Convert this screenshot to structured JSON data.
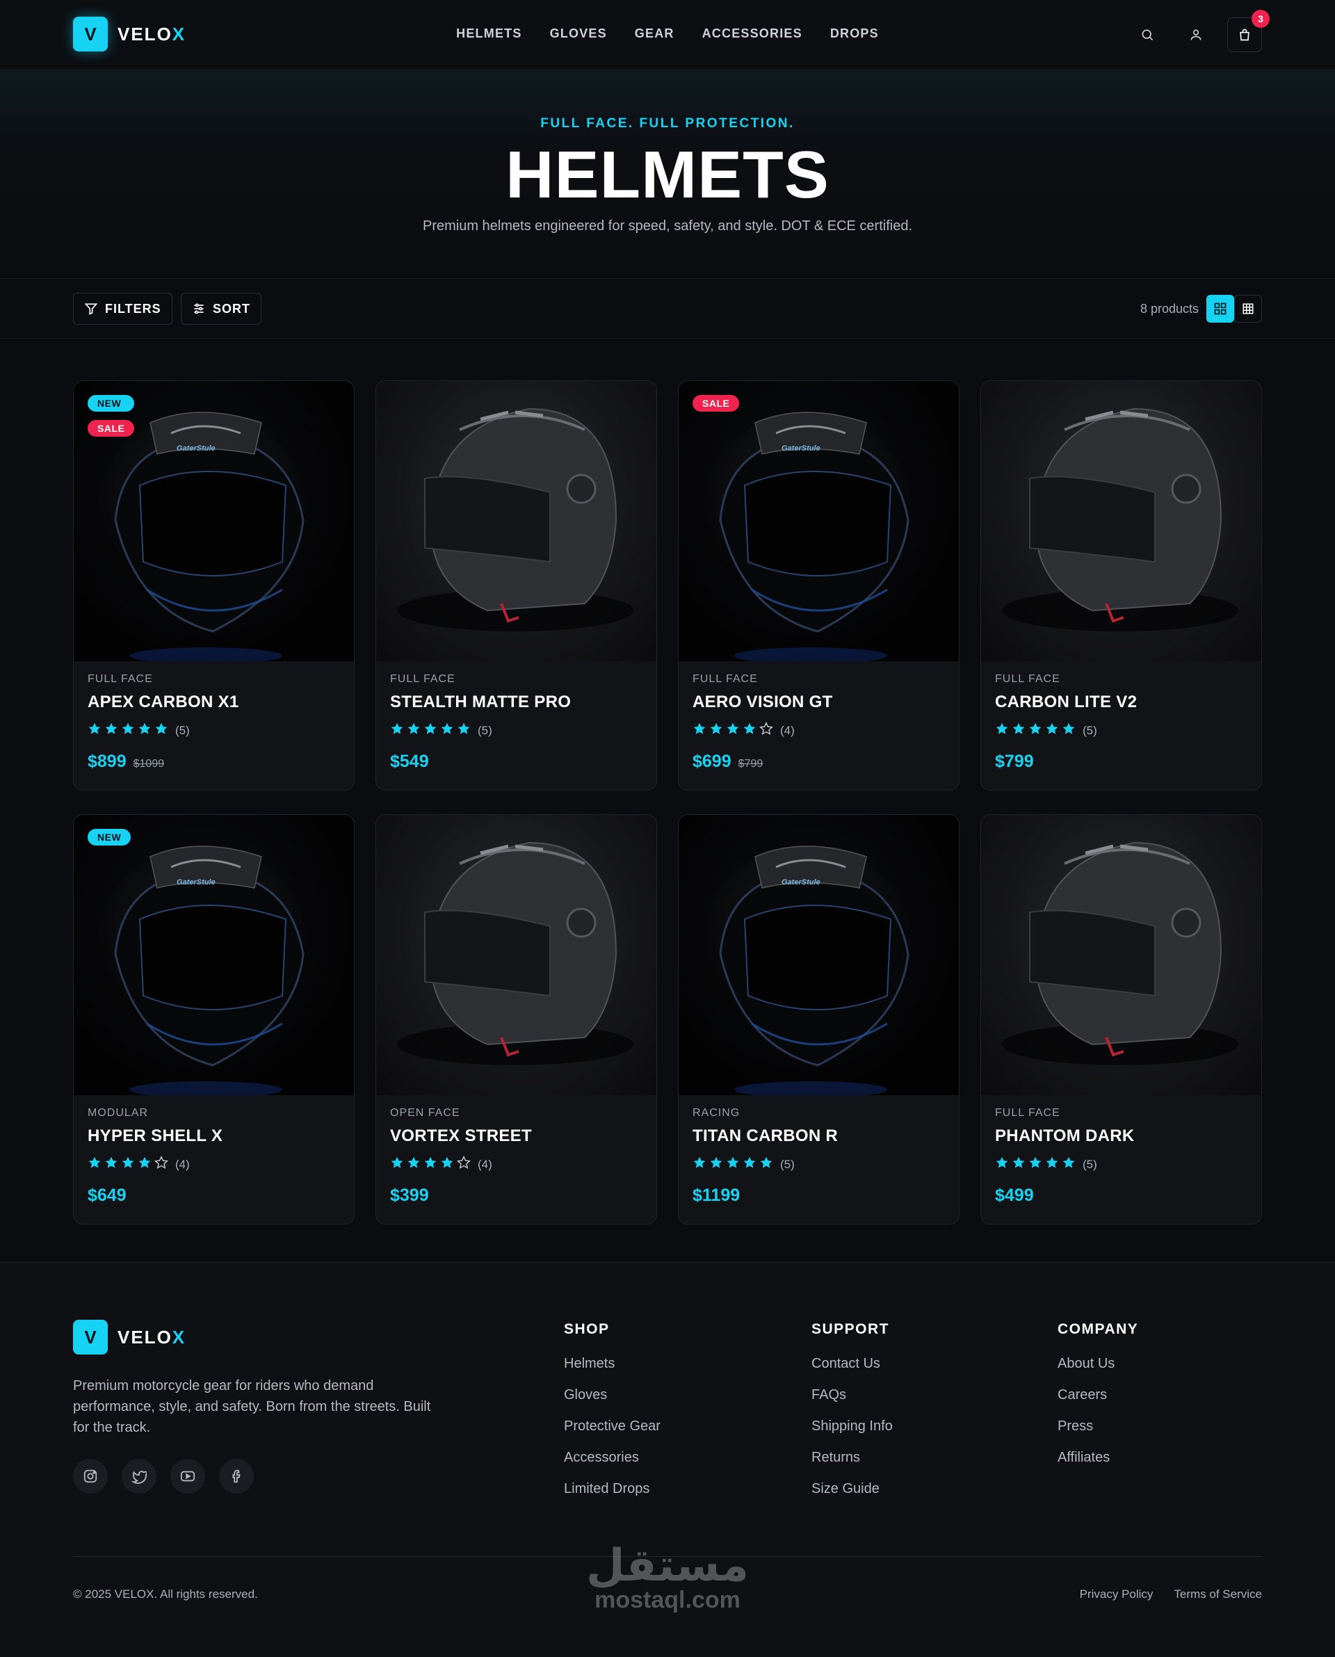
{
  "brand": {
    "letter": "V",
    "name_main": "VELO",
    "name_accent": "X"
  },
  "nav": [
    "HELMETS",
    "GLOVES",
    "GEAR",
    "ACCESSORIES",
    "DROPS"
  ],
  "header": {
    "icons": [
      "search-icon",
      "user-icon",
      "shopping-bag-icon"
    ],
    "cart_count": "3"
  },
  "hero": {
    "eyebrow": "FULL FACE. FULL PROTECTION.",
    "title": "HELMETS",
    "subtitle": "Premium helmets engineered for speed, safety, and style. DOT & ECE certified."
  },
  "toolbar": {
    "filters_label": "FILTERS",
    "sort_label": "SORT",
    "product_count": "8 products",
    "view_active": "grid-4",
    "view_options": [
      "grid-4",
      "grid-9"
    ]
  },
  "colors": {
    "accent": "#16d3f3",
    "sale": "#f0224e",
    "background": "#0b0c0f",
    "card": "#111317"
  },
  "products": [
    {
      "category": "FULL FACE",
      "name": "APEX CARBON X1",
      "rating": 5,
      "reviews": "(5)",
      "price": "$899",
      "old_price": "$1099",
      "badges": [
        "NEW",
        "SALE"
      ],
      "image": "full-face-helmet"
    },
    {
      "category": "FULL FACE",
      "name": "STEALTH MATTE PRO",
      "rating": 5,
      "reviews": "(5)",
      "price": "$549",
      "old_price": "",
      "badges": [],
      "image": "open-face-helmet"
    },
    {
      "category": "FULL FACE",
      "name": "AERO VISION GT",
      "rating": 4,
      "reviews": "(4)",
      "price": "$699",
      "old_price": "$799",
      "badges": [
        "SALE"
      ],
      "image": "full-face-helmet"
    },
    {
      "category": "FULL FACE",
      "name": "CARBON LITE V2",
      "rating": 5,
      "reviews": "(5)",
      "price": "$799",
      "old_price": "",
      "badges": [],
      "image": "open-face-helmet"
    },
    {
      "category": "MODULAR",
      "name": "HYPER SHELL X",
      "rating": 4,
      "reviews": "(4)",
      "price": "$649",
      "old_price": "",
      "badges": [
        "NEW"
      ],
      "image": "full-face-helmet"
    },
    {
      "category": "OPEN FACE",
      "name": "VORTEX STREET",
      "rating": 4,
      "reviews": "(4)",
      "price": "$399",
      "old_price": "",
      "badges": [],
      "image": "open-face-helmet"
    },
    {
      "category": "RACING",
      "name": "TITAN CARBON R",
      "rating": 5,
      "reviews": "(5)",
      "price": "$1199",
      "old_price": "",
      "badges": [],
      "image": "full-face-helmet"
    },
    {
      "category": "FULL FACE",
      "name": "PHANTOM DARK",
      "rating": 5,
      "reviews": "(5)",
      "price": "$499",
      "old_price": "",
      "badges": [],
      "image": "open-face-helmet"
    }
  ],
  "footer": {
    "description": "Premium motorcycle gear for riders who demand performance, style, and safety. Born from the streets. Built for the track.",
    "socials": [
      "instagram-icon",
      "twitter-icon",
      "youtube-icon",
      "facebook-icon"
    ],
    "columns": [
      {
        "title": "SHOP",
        "links": [
          "Helmets",
          "Gloves",
          "Protective Gear",
          "Accessories",
          "Limited Drops"
        ]
      },
      {
        "title": "SUPPORT",
        "links": [
          "Contact Us",
          "FAQs",
          "Shipping Info",
          "Returns",
          "Size Guide"
        ]
      },
      {
        "title": "COMPANY",
        "links": [
          "About Us",
          "Careers",
          "Press",
          "Affiliates"
        ]
      }
    ],
    "copyright": "© 2025 VELOX. All rights reserved.",
    "legal": [
      "Privacy Policy",
      "Terms of Service"
    ],
    "watermark_ar": "مستقل",
    "watermark_en": "mostaql.com"
  }
}
